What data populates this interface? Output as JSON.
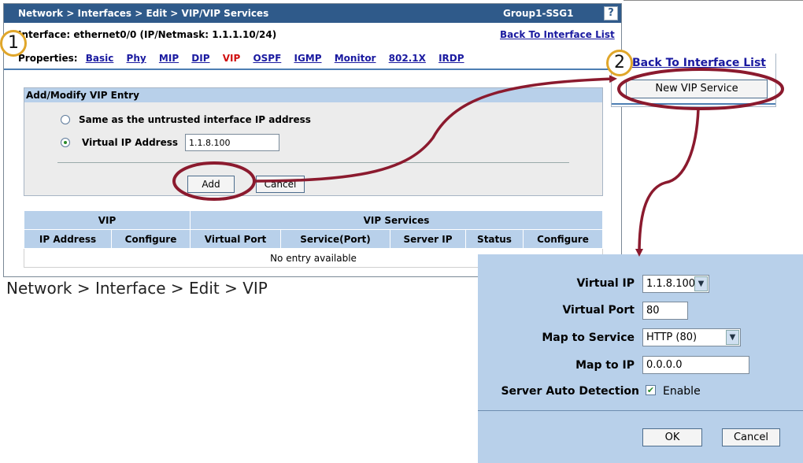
{
  "window": {
    "breadcrumb": "Network > Interfaces > Edit > VIP/VIP Services",
    "device_name": "Group1-SSG1",
    "help_label": "?"
  },
  "interface_info": "Interface: ethernet0/0 (IP/Netmask: 1.1.1.10/24)",
  "back_link_label": "Back To Interface List",
  "properties": {
    "label": "Properties:",
    "tabs": [
      "Basic",
      "Phy",
      "MIP",
      "DIP",
      "VIP",
      "OSPF",
      "IGMP",
      "Monitor",
      "802.1X",
      "IRDP"
    ],
    "active_tab": "VIP"
  },
  "entry_panel": {
    "title": "Add/Modify VIP Entry",
    "option_untrusted": "Same as the untrusted interface IP address",
    "option_vip": "Virtual IP Address",
    "selected_option": "vip",
    "vip_value": "1.1.8.100",
    "add_label": "Add",
    "cancel_label": "Cancel"
  },
  "vip_table": {
    "group_vip": "VIP",
    "group_services": "VIP Services",
    "columns": [
      "IP Address",
      "Configure",
      "Virtual Port",
      "Service(Port)",
      "Server IP",
      "Status",
      "Configure"
    ],
    "empty_text": "No entry available"
  },
  "caption": "Network > Interface > Edit > VIP",
  "steps": {
    "step1": "1",
    "step2": "2"
  },
  "list_panel": {
    "back_link_label": "Back To Interface List",
    "new_vip_label": "New VIP Service"
  },
  "service_dialog": {
    "virtual_ip_label": "Virtual IP",
    "virtual_ip_value": "1.1.8.100",
    "virtual_port_label": "Virtual Port",
    "virtual_port_value": "80",
    "map_service_label": "Map to Service",
    "map_service_value": "HTTP (80)",
    "map_ip_label": "Map to IP",
    "map_ip_value": "0.0.0.0",
    "auto_detect_label": "Server Auto Detection",
    "enable_label": "Enable",
    "enable_checked": true,
    "ok_label": "OK",
    "cancel_label": "Cancel"
  },
  "colors": {
    "title_bar": "#2f5a8a",
    "header_blue": "#b8d0ea",
    "link": "#1a1aa0",
    "active_tab": "#d01010",
    "annotation_ring": "#8b1a2e",
    "step_badge": "#e0a62a"
  }
}
